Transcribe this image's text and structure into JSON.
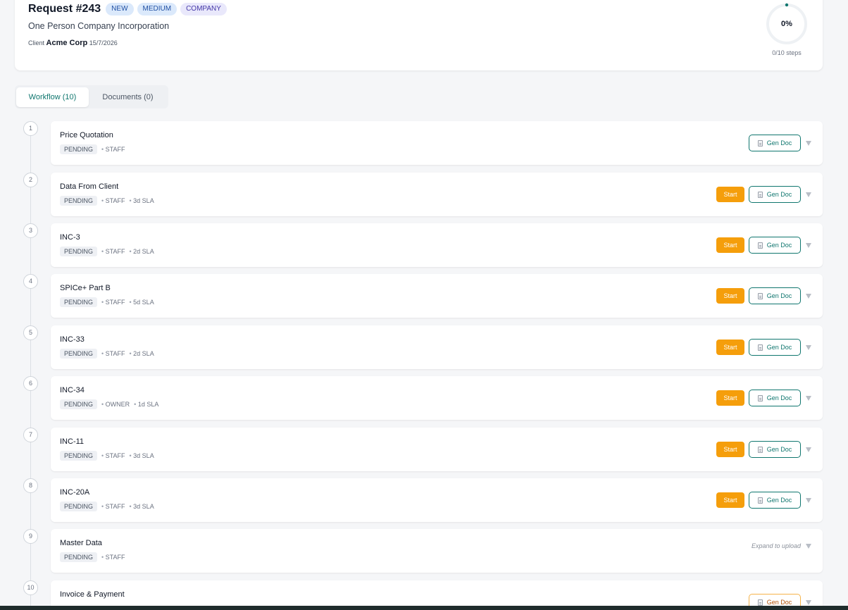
{
  "request": {
    "title": "Request #243",
    "tags": [
      "NEW",
      "MEDIUM",
      "COMPANY"
    ],
    "subtitle": "One Person Company Incorporation",
    "client_prefix": "Client ",
    "client_name": "Acme Corp",
    "date": "15/7/2026",
    "progress_percent": "0%",
    "progress_value": 0,
    "steps_label": "0/10 steps"
  },
  "tabs": [
    {
      "label": "Workflow (10)",
      "active": true
    },
    {
      "label": "Documents (0)",
      "active": false
    }
  ],
  "steps": [
    {
      "num": "1",
      "title": "Price Quotation",
      "status": "PENDING",
      "meta": [
        "STAFF"
      ],
      "start": false,
      "gen_doc": true,
      "expand": false
    },
    {
      "num": "2",
      "title": "Data From Client",
      "status": "PENDING",
      "meta": [
        "STAFF",
        "3d SLA"
      ],
      "start": true,
      "gen_doc": true,
      "expand": false
    },
    {
      "num": "3",
      "title": "INC-3",
      "status": "PENDING",
      "meta": [
        "STAFF",
        "2d SLA"
      ],
      "start": true,
      "gen_doc": true,
      "expand": false
    },
    {
      "num": "4",
      "title": "SPICe+ Part B",
      "status": "PENDING",
      "meta": [
        "STAFF",
        "5d SLA"
      ],
      "start": true,
      "gen_doc": true,
      "expand": false
    },
    {
      "num": "5",
      "title": "INC-33",
      "status": "PENDING",
      "meta": [
        "STAFF",
        "2d SLA"
      ],
      "start": true,
      "gen_doc": true,
      "expand": false
    },
    {
      "num": "6",
      "title": "INC-34",
      "status": "PENDING",
      "meta": [
        "OWNER",
        "1d SLA"
      ],
      "start": true,
      "gen_doc": true,
      "expand": false
    },
    {
      "num": "7",
      "title": "INC-11",
      "status": "PENDING",
      "meta": [
        "STAFF",
        "3d SLA"
      ],
      "start": true,
      "gen_doc": true,
      "expand": false
    },
    {
      "num": "8",
      "title": "INC-20A",
      "status": "PENDING",
      "meta": [
        "STAFF",
        "3d SLA"
      ],
      "start": true,
      "gen_doc": true,
      "expand": false
    },
    {
      "num": "9",
      "title": "Master Data",
      "status": "PENDING",
      "meta": [
        "STAFF"
      ],
      "start": false,
      "gen_doc": false,
      "expand": true
    },
    {
      "num": "10",
      "title": "Invoice & Payment",
      "status": "",
      "meta": [],
      "start": false,
      "gen_doc": true,
      "gen_doc_warn": true,
      "expand": false
    }
  ],
  "labels": {
    "start": "Start",
    "gen_doc": "Gen Doc",
    "expand_hint": "Expand to upload"
  },
  "colors": {
    "accent": "#0f766e",
    "start": "#f59e0b"
  }
}
